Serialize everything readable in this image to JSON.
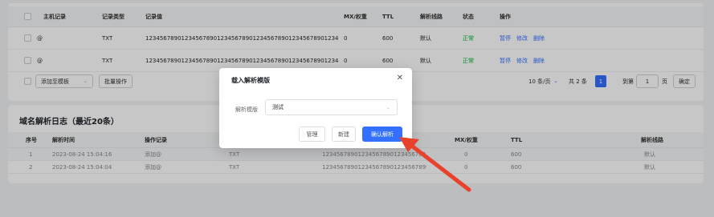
{
  "records_table": {
    "headers": [
      "主机记录",
      "记录类型",
      "记录值",
      "MX/权重",
      "TTL",
      "解析线路",
      "状态",
      "操作"
    ],
    "rows": [
      {
        "host": "@",
        "type": "TXT",
        "value": "12345678901234567890123456789012345678901234567890123456789012345...",
        "mx": "0",
        "ttl": "600",
        "line": "默认",
        "status": "正常"
      },
      {
        "host": "@",
        "type": "TXT",
        "value": "12345678901234567890123456789012345678901234567890123456789012345...",
        "mx": "0",
        "ttl": "600",
        "line": "默认",
        "status": "正常"
      }
    ],
    "actions": [
      "暂停",
      "修改",
      "删除"
    ],
    "toolbar": {
      "add_template": "添加至模板",
      "batch": "批量操作"
    },
    "pagination": {
      "page_size": "10 条/页",
      "total": "共 2 条",
      "current_page": "1",
      "goto_label": "到第",
      "goto_value": "1",
      "page_unit": "页",
      "confirm": "确定"
    }
  },
  "log": {
    "title": "域名解析日志（最近20条）",
    "headers": [
      "序号",
      "解析时间",
      "操作记录",
      "",
      "",
      "MX/权重",
      "TTL",
      "解析线路"
    ],
    "rows": [
      {
        "index": "1",
        "time": "2023-08-24 15:04:16",
        "op": "添加@",
        "type": "TXT",
        "value": "12345678901234567890123456789...",
        "mx": "0",
        "ttl": "600",
        "line": "默认"
      },
      {
        "index": "2",
        "time": "2023-08-24 15:04:04",
        "op": "添加@",
        "type": "TXT",
        "value": "12345678901234567890123456789901...",
        "mx": "0",
        "ttl": "600",
        "line": "默认"
      }
    ]
  },
  "modal": {
    "title": "载入解析模版",
    "field_label": "解析模版",
    "field_value": "测试",
    "buttons": {
      "manage": "管理",
      "new": "新建",
      "confirm": "确认解析"
    }
  },
  "colors": {
    "accent": "#3370ff",
    "ok": "#00b42a",
    "arrow": "#e8412c"
  }
}
